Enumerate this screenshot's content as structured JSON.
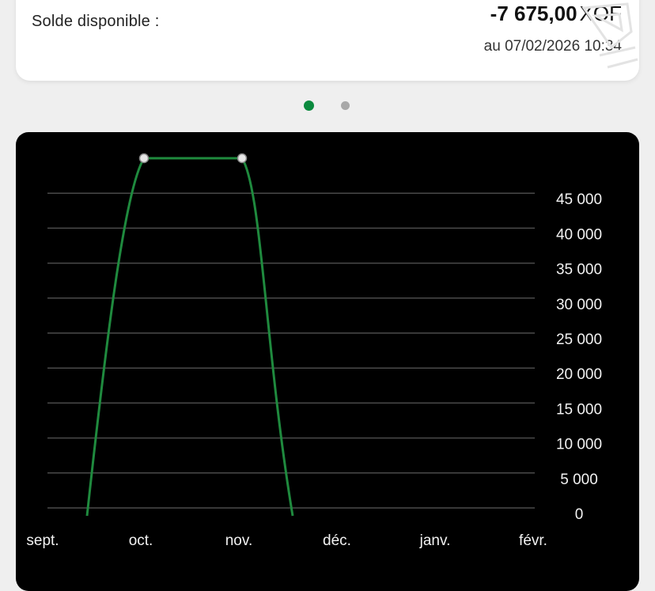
{
  "balance": {
    "label": "Solde disponible :",
    "amount": "-7 675,00",
    "currency": "XOF",
    "date": "au 07/02/2026 10:34"
  },
  "pager": {
    "pages": 2,
    "active_index": 0,
    "active_color": "#0b8a3e",
    "inactive_color": "#a8a8a8"
  },
  "chart_data": {
    "type": "line",
    "x": [
      "sept.",
      "oct.",
      "nov.",
      "déc.",
      "janv.",
      "févr."
    ],
    "series": [
      {
        "values": [
          0,
          50000,
          50000,
          0,
          null,
          null
        ],
        "color": "#1f8a3e"
      }
    ],
    "yticks": [
      "0",
      "5 000",
      "10 000",
      "15 000",
      "20 000",
      "25 000",
      "30 000",
      "35 000",
      "40 000",
      "45 000"
    ],
    "ylim": [
      0,
      50000
    ],
    "grid": true,
    "legend": "none",
    "yaxis_position": "right"
  }
}
